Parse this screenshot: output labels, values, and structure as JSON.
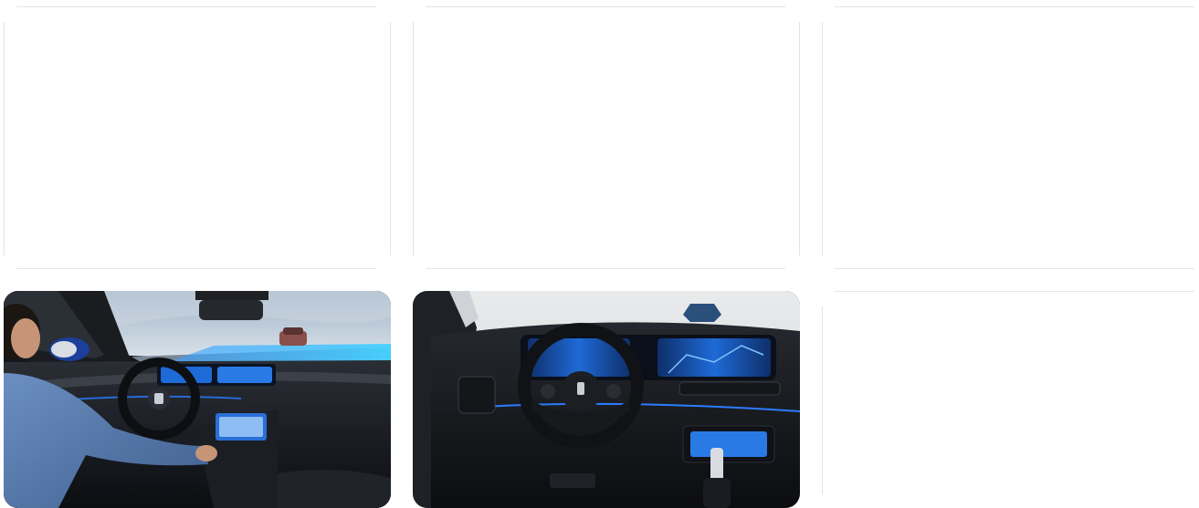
{
  "grid": {
    "cards": [
      {
        "id": "card-1",
        "type": "empty"
      },
      {
        "id": "card-2",
        "type": "empty"
      },
      {
        "id": "card-3",
        "type": "empty"
      },
      {
        "id": "card-4",
        "type": "photo",
        "subject": "driver-interior-lane-assist"
      },
      {
        "id": "card-5",
        "type": "photo",
        "subject": "dashboard-steering-wheel"
      },
      {
        "id": "card-6",
        "type": "empty"
      }
    ]
  },
  "colors": {
    "divider": "#e6e6e6",
    "screen_blue": "#1e6ad6",
    "interior_dark": "#1a1d22",
    "ambient_light": "#2c7bff"
  }
}
